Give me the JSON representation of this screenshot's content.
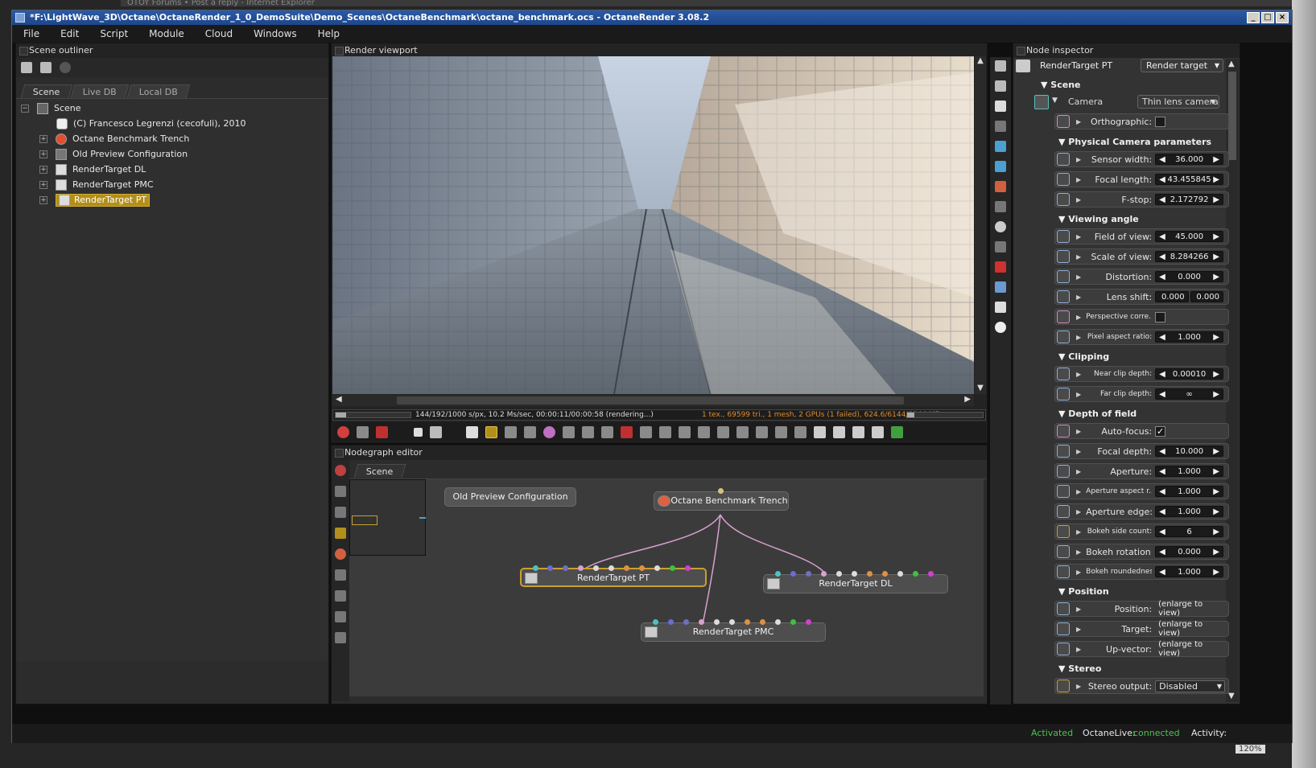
{
  "background": {
    "strip_text": "OTOY Forums • Post a reply - Internet Explorer",
    "zoom": "120%"
  },
  "window": {
    "title": "*F:\\LightWave_3D\\Octane\\OctaneRender_1_0_DemoSuite\\Demo_Scenes\\OctaneBenchmark\\octane_benchmark.ocs - OctaneRender 3.08.2"
  },
  "menu": [
    "File",
    "Edit",
    "Script",
    "Module",
    "Cloud",
    "Windows",
    "Help"
  ],
  "outliner": {
    "title": "Scene outliner",
    "tabs": [
      "Scene",
      "Live DB",
      "Local DB"
    ],
    "items": [
      {
        "label": "Scene"
      },
      {
        "label": "(C) Francesco Legrenzi (cecofuli), 2010"
      },
      {
        "label": "Octane Benchmark Trench"
      },
      {
        "label": "Old Preview Configuration"
      },
      {
        "label": "RenderTarget DL"
      },
      {
        "label": "RenderTarget PMC"
      },
      {
        "label": "RenderTarget PT"
      }
    ]
  },
  "viewport": {
    "title": "Render viewport",
    "stats_left": "144/192/1000 s/px, 10.2 Ms/sec, 00:00:11/00:00:58 (rendering...)",
    "stats_right": "1 tex., 69599 tri., 1 mesh, 2 GPUs (1 failed), 624.6/6144/6144 MB",
    "progress": 0.144
  },
  "nodegraph": {
    "title": "Nodegraph editor",
    "tab": "Scene",
    "nodes": {
      "old_preview": "Old Preview Configuration",
      "trench": "Octane Benchmark Trench",
      "rt_pt": "RenderTarget PT",
      "rt_dl": "RenderTarget DL",
      "rt_pmc": "RenderTarget PMC"
    }
  },
  "inspector": {
    "title": "Node inspector",
    "node_name": "RenderTarget PT",
    "node_type": "Render target",
    "scene_label": "Scene",
    "camera_label": "Camera",
    "camera_type": "Thin lens camera",
    "sections": {
      "physical": "Physical Camera parameters",
      "viewing": "Viewing angle",
      "clipping": "Clipping",
      "dof": "Depth of field",
      "position": "Position",
      "stereo": "Stereo"
    },
    "orthographic": "Orthographic:",
    "sensor_width": {
      "label": "Sensor width:",
      "value": "36.000"
    },
    "focal_length": {
      "label": "Focal length:",
      "value": "43.455845"
    },
    "fstop": {
      "label": "F-stop:",
      "value": "2.172792"
    },
    "fov": {
      "label": "Field of view:",
      "value": "45.000"
    },
    "scale_of_view": {
      "label": "Scale of view:",
      "value": "8.284266"
    },
    "distortion": {
      "label": "Distortion:",
      "value": "0.000"
    },
    "lens_shift": {
      "label": "Lens shift:",
      "value1": "0.000",
      "value2": "0.000"
    },
    "perspective": "Perspective corre...",
    "pixel_aspect": {
      "label": "Pixel aspect ratio:",
      "value": "1.000"
    },
    "near_clip": {
      "label": "Near clip depth:",
      "value": "0.00010"
    },
    "far_clip": {
      "label": "Far clip depth:",
      "value": "∞"
    },
    "autofocus": "Auto-focus:",
    "focal_depth": {
      "label": "Focal depth:",
      "value": "10.000"
    },
    "aperture": {
      "label": "Aperture:",
      "value": "1.000"
    },
    "aperture_aspect": {
      "label": "Aperture aspect r...",
      "value": "1.000"
    },
    "aperture_edge": {
      "label": "Aperture edge:",
      "value": "1.000"
    },
    "bokeh_side": {
      "label": "Bokeh side count:",
      "value": "6"
    },
    "bokeh_rotation": {
      "label": "Bokeh rotation:",
      "value": "0.000"
    },
    "bokeh_round": {
      "label": "Bokeh roundedness:",
      "value": "1.000"
    },
    "position": {
      "label": "Position:",
      "value": "(enlarge to view)"
    },
    "target": {
      "label": "Target:",
      "value": "(enlarge to view)"
    },
    "upvector": {
      "label": "Up-vector:",
      "value": "(enlarge to view)"
    },
    "stereo_output": {
      "label": "Stereo output:",
      "value": "Disabled"
    }
  },
  "status": {
    "activated": "Activated",
    "live_label": "OctaneLive:",
    "live_value": "connected",
    "activity": "Activity:"
  },
  "colors": {
    "accent": "#b28f1a",
    "status_green": "#4ec24e",
    "orange_text": "#e08a2a"
  }
}
